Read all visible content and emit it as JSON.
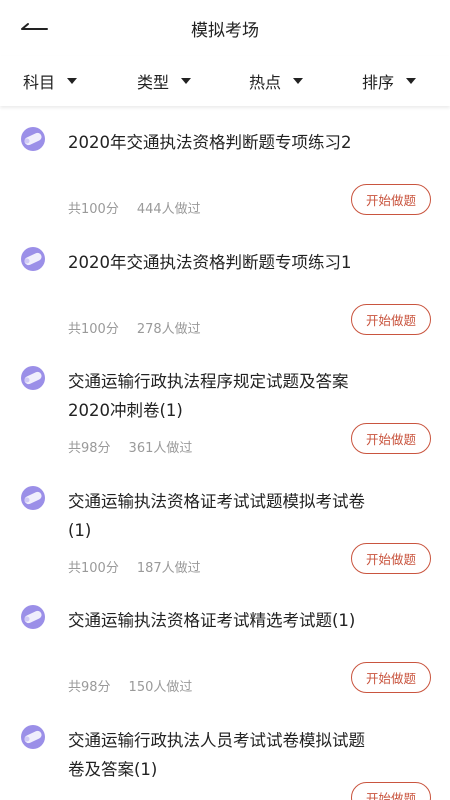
{
  "header": {
    "title": "模拟考场"
  },
  "filters": [
    {
      "label": "科目"
    },
    {
      "label": "类型"
    },
    {
      "label": "热点"
    },
    {
      "label": "排序"
    }
  ],
  "start_label": "开始做题",
  "items": [
    {
      "title": "2020年交通执法资格判断题专项练习2",
      "count": "共100分",
      "done": "444人做过"
    },
    {
      "title": "2020年交通执法资格判断题专项练习1",
      "count": "共100分",
      "done": "278人做过"
    },
    {
      "title": "交通运输行政执法程序规定试题及答案2020冲刺卷(1)",
      "count": "共98分",
      "done": "361人做过"
    },
    {
      "title": "交通运输执法资格证考试试题模拟考试卷(1)",
      "count": "共100分",
      "done": "187人做过"
    },
    {
      "title": "交通运输执法资格证考试精选考试题(1)",
      "count": "共98分",
      "done": "150人做过"
    },
    {
      "title": "交通运输行政执法人员考试试卷模拟试题卷及答案(1)",
      "count": "",
      "done": ""
    }
  ],
  "colors": {
    "accent": "#c9553f",
    "icon": "#9b8fe8",
    "meta": "#9a9a9a"
  },
  "icons": {
    "back": "back-arrow-icon",
    "item": "exam-scroll-icon",
    "filter": "caret-down-icon"
  }
}
